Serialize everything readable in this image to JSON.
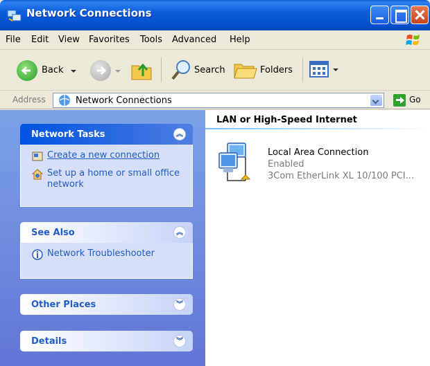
{
  "window": {
    "title": "Network Connections",
    "title_icon": "network-connections-icon"
  },
  "menu": {
    "items": [
      "File",
      "Edit",
      "View",
      "Favorites",
      "Tools",
      "Advanced",
      "Help"
    ]
  },
  "toolbar": {
    "back_label": "Back",
    "search_label": "Search",
    "folders_label": "Folders"
  },
  "address": {
    "label": "Address",
    "value": "Network Connections",
    "go_label": "Go"
  },
  "left_pane": {
    "network_tasks": {
      "title": "Network Tasks",
      "items": [
        {
          "label": "Create a new connection",
          "icon": "new-connection-icon"
        },
        {
          "label": "Set up a home or small office network",
          "icon": "home-network-icon"
        }
      ]
    },
    "see_also": {
      "title": "See Also",
      "items": [
        {
          "label": "Network Troubleshooter",
          "icon": "info-icon"
        }
      ]
    },
    "other_places": {
      "title": "Other Places"
    },
    "details": {
      "title": "Details"
    }
  },
  "content": {
    "section_title": "LAN or High-Speed Internet",
    "connection": {
      "name": "Local Area Connection",
      "status": "Enabled",
      "device": "3Com EtherLink XL 10/100 PCI..."
    }
  },
  "colors": {
    "titlebar": "#0a5fd8",
    "taskpane": "#7ba2e7",
    "link": "#215dc6",
    "special_header": "#0054e3"
  }
}
